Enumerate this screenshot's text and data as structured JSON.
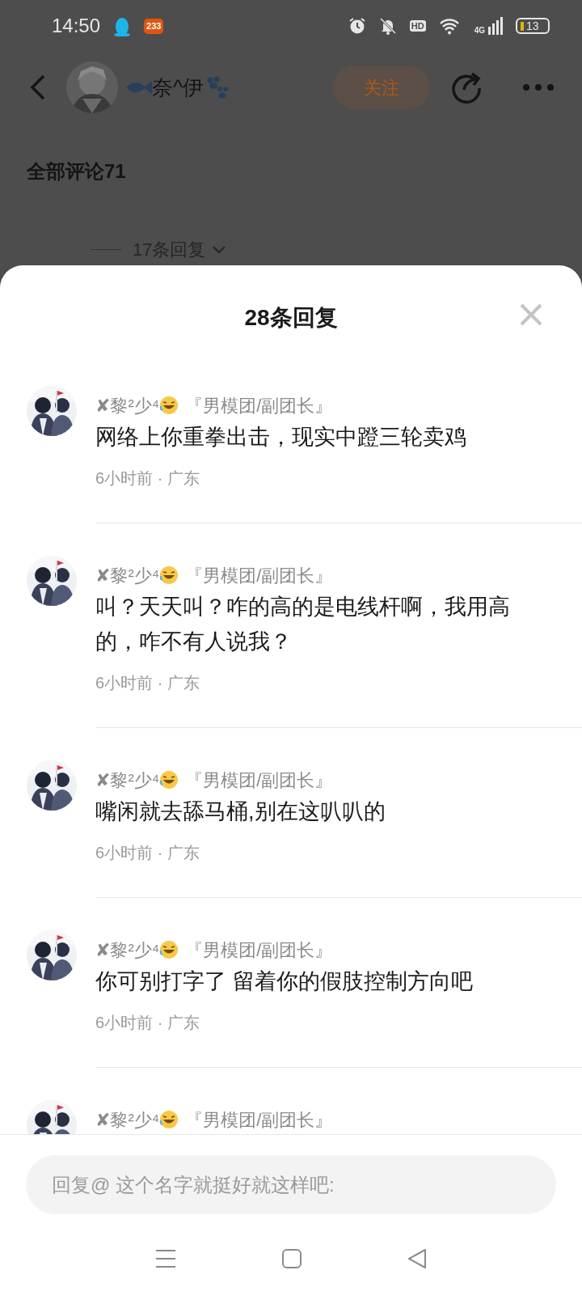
{
  "status_bar": {
    "time": "14:50",
    "app_badge": "233",
    "hd_label": "HD",
    "network": "4G",
    "battery": "13"
  },
  "header": {
    "user_name": "奈^伊",
    "follow_button": "关注"
  },
  "comments_heading": "全部评论71",
  "reply_toggle": {
    "label": "17条回复"
  },
  "sheet": {
    "title": "28条回复",
    "replies": [
      {
        "name": "✘黎²少⁴",
        "badge": "『男模团/副团长』",
        "text": "网络上你重拳出击，现实中蹬三轮卖鸡",
        "time": "6小时前 · 广东"
      },
      {
        "name": "✘黎²少⁴",
        "badge": "『男模团/副团长』",
        "text": "叫？天天叫？咋的高的是电线杆啊，我用高的，咋不有人说我？",
        "time": "6小时前 · 广东"
      },
      {
        "name": "✘黎²少⁴",
        "badge": "『男模团/副团长』",
        "text": "嘴闲就去舔马桶,别在这叭叭的",
        "time": "6小时前 · 广东"
      },
      {
        "name": "✘黎²少⁴",
        "badge": "『男模团/副团长』",
        "text": "你可别打字了 留着你的假肢控制方向吧",
        "time": "6小时前 · 广东"
      },
      {
        "name": "✘黎²少⁴",
        "badge": "『男模团/副团长』"
      }
    ],
    "input": {
      "placeholder": "回复@ 这个名字就挺好就这样吧:"
    }
  }
}
